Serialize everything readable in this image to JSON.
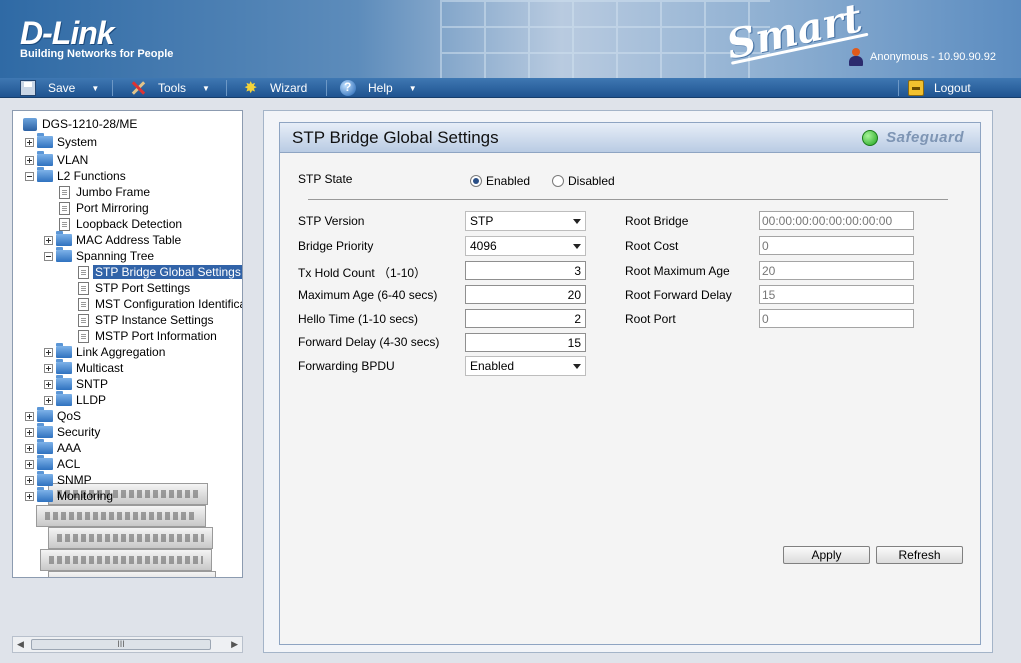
{
  "header": {
    "brand": "D-Link",
    "tagline": "Building Networks for People",
    "product": "Smart",
    "user": "Anonymous - 10.90.90.92"
  },
  "menu": {
    "save": "Save",
    "tools": "Tools",
    "wizard": "Wizard",
    "help": "Help",
    "logout": "Logout"
  },
  "tree": {
    "root": "DGS-1210-28/ME",
    "system": "System",
    "vlan": "VLAN",
    "l2": "L2 Functions",
    "jumbo": "Jumbo Frame",
    "mirroring": "Port Mirroring",
    "loopback": "Loopback Detection",
    "mac": "MAC Address Table",
    "stp": "Spanning Tree",
    "stp_global": "STP Bridge Global Settings",
    "stp_port": "STP Port Settings",
    "mst_config": "MST Configuration Identification",
    "stp_instance": "STP Instance Settings",
    "mstp_info": "MSTP Port Information",
    "link_agg": "Link Aggregation",
    "multicast": "Multicast",
    "sntp": "SNTP",
    "lldp": "LLDP",
    "qos": "QoS",
    "security": "Security",
    "aaa": "AAA",
    "acl": "ACL",
    "snmp": "SNMP",
    "monitoring": "Monitoring",
    "scroll_grip": "III"
  },
  "panel": {
    "title": "STP Bridge Global Settings",
    "safeguard": "Safeguard",
    "stp_state_label": "STP State",
    "enabled": "Enabled",
    "disabled": "Disabled",
    "stp_state_selected": "Enabled",
    "left_fields": {
      "stp_version": {
        "label": "STP Version",
        "value": "STP"
      },
      "bridge_priority": {
        "label": "Bridge Priority",
        "value": "4096"
      },
      "tx_hold": {
        "label": "Tx Hold Count （1-10）",
        "value": "3"
      },
      "max_age": {
        "label": "Maximum Age (6-40 secs)",
        "value": "20"
      },
      "hello_time": {
        "label": "Hello Time (1-10 secs)",
        "value": "2"
      },
      "fwd_delay": {
        "label": "Forward Delay (4-30 secs)",
        "value": "15"
      },
      "fwd_bpdu": {
        "label": "Forwarding BPDU",
        "value": "Enabled"
      }
    },
    "right_fields": {
      "root_bridge": {
        "label": "Root Bridge",
        "value": "00:00:00:00:00:00:00:00"
      },
      "root_cost": {
        "label": "Root Cost",
        "value": "0"
      },
      "root_max_age": {
        "label": "Root Maximum Age",
        "value": "20"
      },
      "root_fwd_delay": {
        "label": "Root Forward Delay",
        "value": "15"
      },
      "root_port": {
        "label": "Root Port",
        "value": "0"
      }
    },
    "apply": "Apply",
    "refresh": "Refresh"
  }
}
